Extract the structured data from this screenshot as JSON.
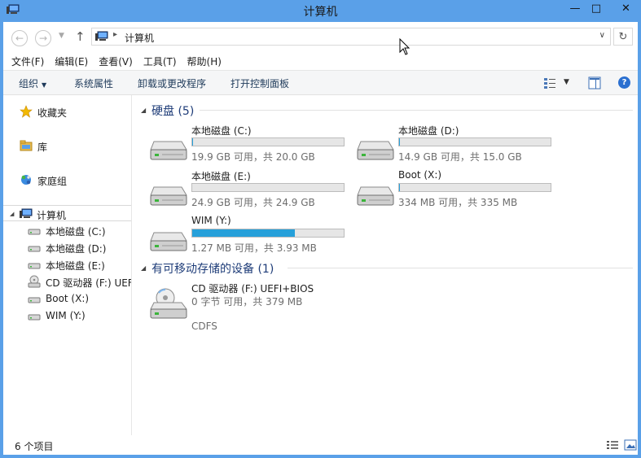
{
  "window": {
    "title": "计算机"
  },
  "address": {
    "crumb": "计算机"
  },
  "menu": [
    "文件(F)",
    "编辑(E)",
    "查看(V)",
    "工具(T)",
    "帮助(H)"
  ],
  "commands": {
    "organize": "组织",
    "properties": "系统属性",
    "uninstall": "卸载或更改程序",
    "control_panel": "打开控制面板"
  },
  "nav": {
    "favorites": "收藏夹",
    "libraries": "库",
    "homegroup": "家庭组",
    "computer": "计算机",
    "drives": [
      "本地磁盘 (C:)",
      "本地磁盘 (D:)",
      "本地磁盘 (E:)",
      "CD 驱动器 (F:) UEFI+BIOS",
      "Boot (X:)",
      "WIM (Y:)"
    ]
  },
  "groups": {
    "hard_disks": "硬盘 (5)",
    "removable": "有可移动存储的设备 (1)"
  },
  "drives": [
    {
      "name": "本地磁盘 (C:)",
      "info": "19.9 GB 可用，共 20.0 GB",
      "used_fraction": 0.005
    },
    {
      "name": "本地磁盘 (D:)",
      "info": "14.9 GB 可用，共 15.0 GB",
      "used_fraction": 0.007
    },
    {
      "name": "本地磁盘 (E:)",
      "info": "24.9 GB 可用，共 24.9 GB",
      "used_fraction": 0.0
    },
    {
      "name": "Boot (X:)",
      "info": "334 MB 可用，共 335 MB",
      "used_fraction": 0.003
    },
    {
      "name": "WIM (Y:)",
      "info": "1.27 MB 可用，共 3.93 MB",
      "used_fraction": 0.68
    }
  ],
  "cd": {
    "name": "CD 驱动器 (F:) UEFI+BIOS",
    "info": "0 字节 可用，共 379 MB",
    "fs": "CDFS"
  },
  "status": {
    "count": "6 个项目"
  },
  "colors": {
    "accent": "#5aa0e8",
    "bar_fill": "#26a0da",
    "group_title": "#1e3c78"
  }
}
